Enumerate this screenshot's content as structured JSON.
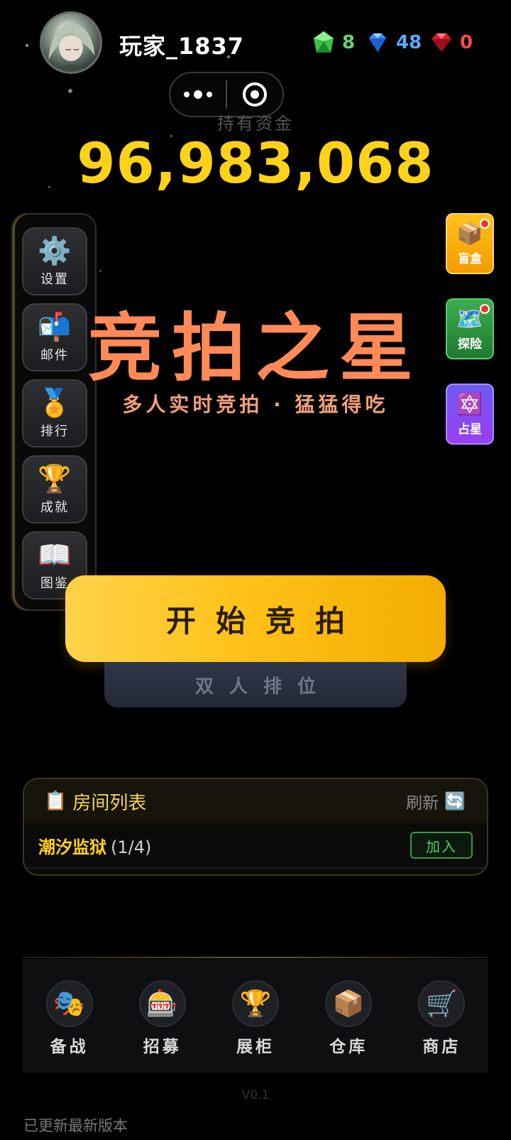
{
  "header": {
    "username": "玩家_1837",
    "resources": [
      {
        "name": "green-gem",
        "value": "8",
        "color": "#5fd86e"
      },
      {
        "name": "blue-diamond",
        "value": "48",
        "color": "#5aa8ff"
      },
      {
        "name": "red-ruby",
        "value": "0",
        "color": "#ff4a4a"
      }
    ]
  },
  "funds": {
    "label": "持有资金",
    "amount": "96,983,068"
  },
  "left_menu": [
    {
      "icon": "⚙️",
      "label": "设置"
    },
    {
      "icon": "📬",
      "label": "邮件"
    },
    {
      "icon": "🏅",
      "label": "排行"
    },
    {
      "icon": "🏆",
      "label": "成就"
    },
    {
      "icon": "📖",
      "label": "图鉴"
    }
  ],
  "title": "竞拍之星",
  "subtitle": "多人实时竞拍 · 猛猛得吃",
  "right_buttons": [
    {
      "icon": "📦",
      "label": "盲盒",
      "color": "#f5a800",
      "badge": true
    },
    {
      "icon": "🗺️",
      "label": "探险",
      "color": "#2f9a42",
      "badge": true
    },
    {
      "icon": "🔯",
      "label": "占星",
      "color": "#7a4cf0",
      "badge": false
    }
  ],
  "start_button": "开始竞拍",
  "duo_button": "双人排位",
  "room_list": {
    "title": "房间列表",
    "title_icon": "📋",
    "refresh": "刷新",
    "refresh_icon": "🔄",
    "rooms": [
      {
        "name": "潮汐监狱",
        "count": "(1/4)",
        "join": "加入"
      }
    ]
  },
  "bottom_nav": [
    {
      "icon": "🎭",
      "label": "备战"
    },
    {
      "icon": "🎰",
      "label": "招募"
    },
    {
      "icon": "🏆",
      "label": "展柜"
    },
    {
      "icon": "📦",
      "label": "仓库"
    },
    {
      "icon": "🛒",
      "label": "商店"
    }
  ],
  "version": "V0.1",
  "update_note": "已更新最新版本"
}
